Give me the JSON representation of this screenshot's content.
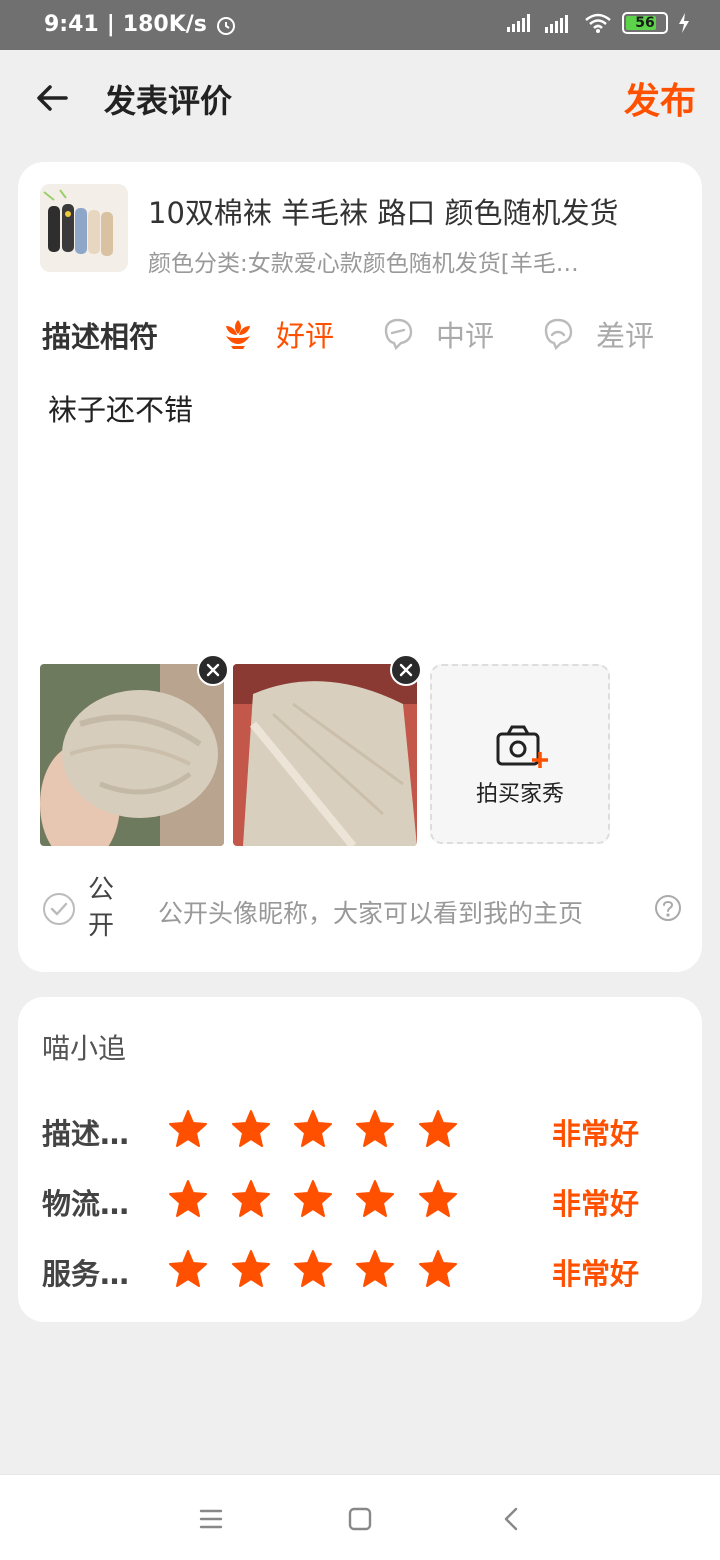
{
  "status_bar": {
    "time": "9:41",
    "speed": "180K/s",
    "battery": "56",
    "icons": [
      "alarm-icon",
      "signal-icon",
      "hd-signal-icon",
      "wifi-icon",
      "battery-icon",
      "charging-icon"
    ]
  },
  "header": {
    "title": "发表评价",
    "publish_label": "发布"
  },
  "product": {
    "title": "10双棉袜 羊毛袜 路口 颜色随机发货",
    "sku": "颜色分类:女款爱心款颜色随机发货[羊毛…"
  },
  "rating": {
    "label": "描述相符",
    "options": [
      "好评",
      "中评",
      "差评"
    ],
    "selected": "好评"
  },
  "review_text": "袜子还不错",
  "photos": {
    "count": 2,
    "add_label": "拍买家秀"
  },
  "public": {
    "label": "公开",
    "description": "公开头像昵称，大家可以看到我的主页",
    "checked": false
  },
  "shop": {
    "name": "喵小追",
    "scores": [
      {
        "label": "描述…",
        "stars": 5,
        "text": "非常好"
      },
      {
        "label": "物流…",
        "stars": 5,
        "text": "非常好"
      },
      {
        "label": "服务…",
        "stars": 5,
        "text": "非常好"
      }
    ]
  },
  "colors": {
    "accent": "#ff5000",
    "background": "#efefef",
    "card": "#ffffff",
    "muted": "#999999"
  }
}
